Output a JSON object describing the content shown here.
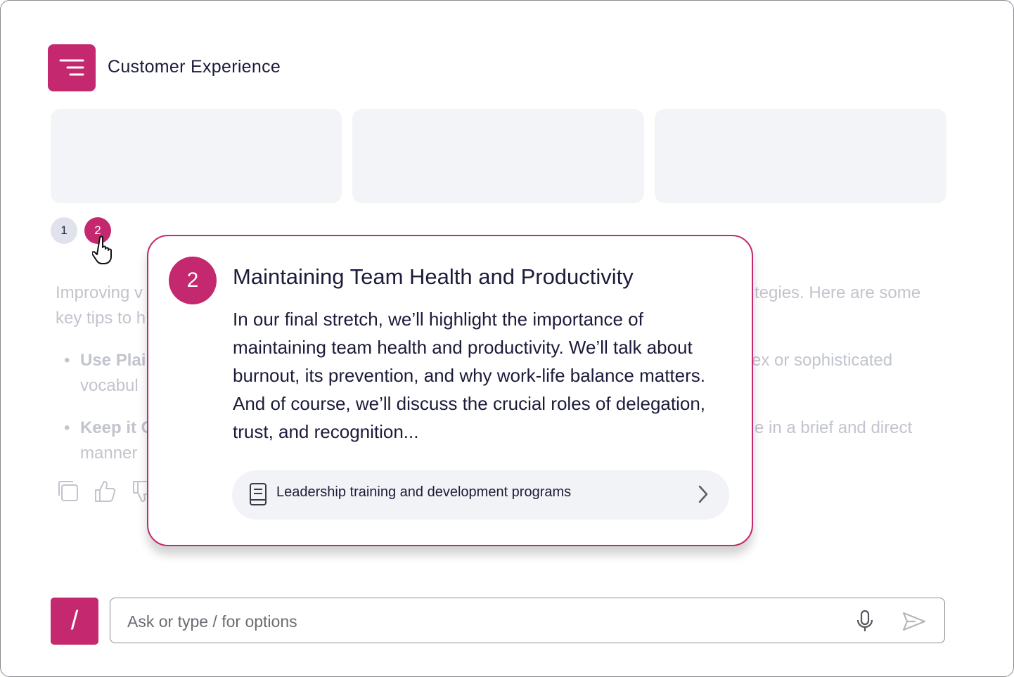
{
  "header": {
    "title": "Customer Experience",
    "menu_icon": "menu-icon"
  },
  "pagination": {
    "pages": [
      "1",
      "2"
    ],
    "active": "2"
  },
  "background_text": {
    "para_left_1": "Improving v",
    "para_right_1": "tegies. Here are some",
    "para_left_2": "key tips to h",
    "bullet1_bold": "Use Plai",
    "bullet1_right": "ex or sophisticated",
    "bullet1_line2": "vocabul",
    "bullet2_bold": "Keep it C",
    "bullet2_right": "e in a brief and direct",
    "bullet2_line2": "manner"
  },
  "popover": {
    "badge": "2",
    "title": "Maintaining Team Health and Productivity",
    "body": "In our final stretch, we’ll highlight the importance of maintaining team health and productivity. We’ll talk about burnout, its prevention, and why work-life balance matters. And of course, we’ll discuss the crucial roles of delegation, trust, and recognition...",
    "source_label": "Leadership training and development programs"
  },
  "composer": {
    "slash_label": "/",
    "placeholder": "Ask or type / for options"
  },
  "colors": {
    "accent": "#c4286e",
    "card_bg": "#f3f4f7",
    "faded_text": "#c2c4ce",
    "text": "#1b1b3a"
  }
}
